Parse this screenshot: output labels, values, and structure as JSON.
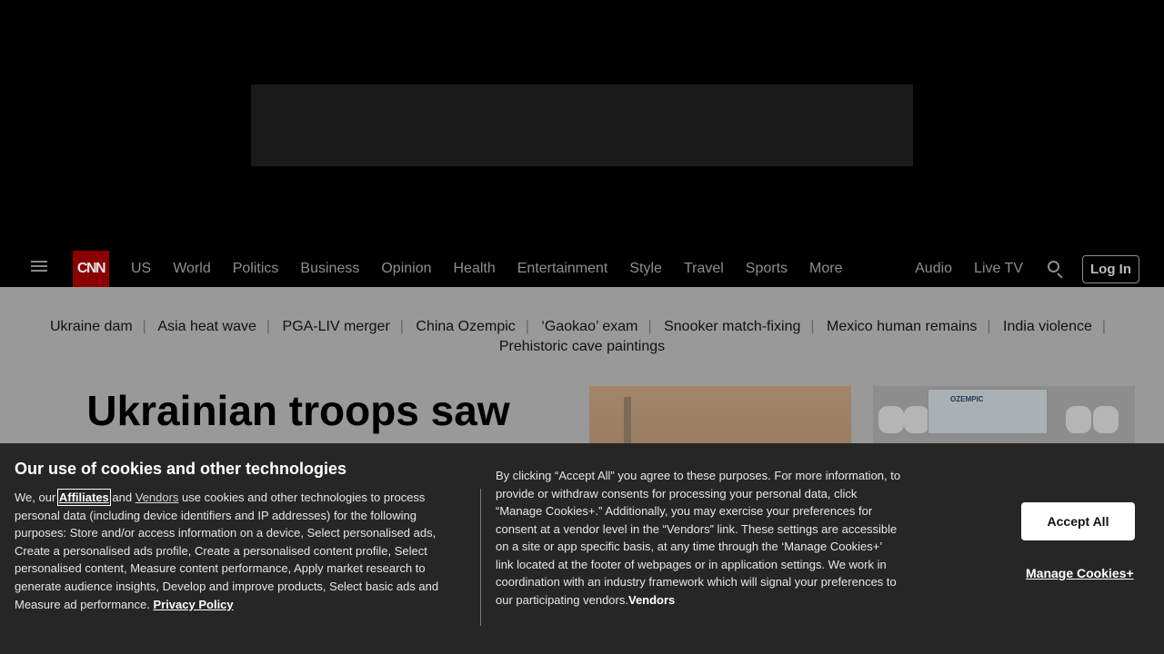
{
  "nav": {
    "logo": "CNN",
    "links": [
      "US",
      "World",
      "Politics",
      "Business",
      "Opinion",
      "Health",
      "Entertainment",
      "Style",
      "Travel",
      "Sports",
      "More"
    ],
    "audio": "Audio",
    "live_tv": "Live TV",
    "login": "Log In"
  },
  "trending": [
    "Ukraine dam",
    "Asia heat wave",
    "PGA-LIV merger",
    "China Ozempic",
    "‘Gaokao’ exam",
    "Snooker match-fixing",
    "Mexico human remains",
    "India violence",
    "Prehistoric cave paintings"
  ],
  "headline": "Ukrainian troops saw",
  "thumb2_label": "OZEMPIC",
  "cookie": {
    "title": "Our use of cookies and other technologies",
    "left_p1": "We, our ",
    "affiliates": "Affiliates",
    "left_p2": " and ",
    "vendors": "Vendors",
    "left_p3": " use cookies and other technologies to process personal data (including device identifiers and IP addresses) for the following purposes: Store and/or access information on a device, Select personalised ads, Create a personalised ads profile, Create a personalised content profile, Select personalised content, Measure content performance, Apply market research to generate audience insights, Develop and improve products, Select basic ads and Measure ad performance. ",
    "privacy_policy": "Privacy Policy",
    "right_text": "By clicking “Accept All” you agree to these purposes. For more information, to provide or withdraw consents for processing your personal data, click “Manage Cookies+.” Additionally, you may exercise your preferences for consent at a vendor level in the “Vendors” link. These settings are accessible on a site or app specific basis, at any time through the ‘Manage Cookies+’ link located at the footer of webpages or in application settings. We work in coordination with an industry framework which will signal your preferences to our participating vendors.",
    "right_vendors": "Vendors",
    "accept_all": "Accept All",
    "manage": "Manage Cookies+"
  }
}
